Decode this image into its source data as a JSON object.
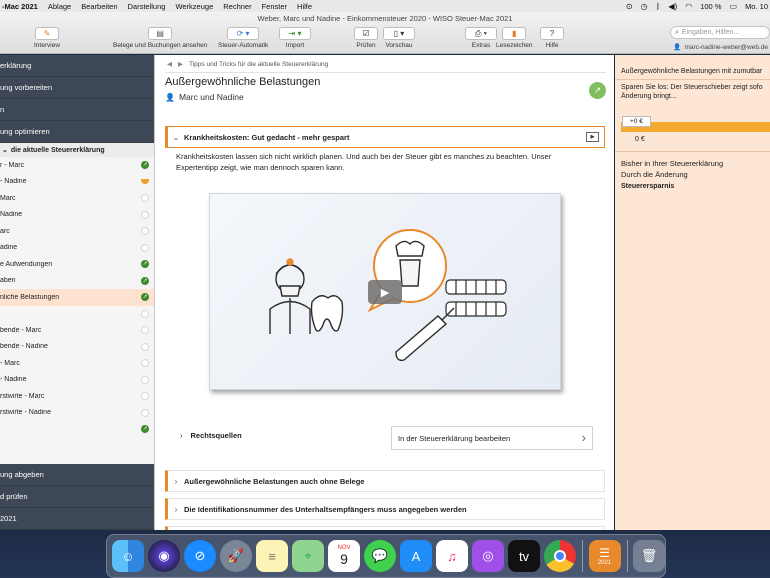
{
  "menubar": {
    "app": "-Mac 2021",
    "items": [
      "Ablage",
      "Bearbeiten",
      "Darstellung",
      "Werkzeuge",
      "Rechner",
      "Fenster",
      "Hilfe"
    ],
    "battery": "100 %",
    "day": "Mo. 10"
  },
  "window": {
    "title": "Weber, Marc und Nadine - Einkommensteuer 2020 - WISO Steuer-Mac 2021"
  },
  "toolbar": {
    "interview": "Interview",
    "belege": "Belege und Buchungen ansehen",
    "automatik": "Steuer-Automatik",
    "import": "Import",
    "pruefen": "Prüfen",
    "vorschau": "Vorschau",
    "extras": "Extras",
    "lesezeichen": "Lesezeichen",
    "hilfe": "Hilfe",
    "search_placeholder": "Eingaben, Hilfen...",
    "user": "marc-nadine-weber@web.de"
  },
  "sidebar": {
    "top": [
      "erklärung",
      "ung vorbereiten",
      "n",
      "ung optimieren"
    ],
    "section": "die aktuelle Steuererklärung",
    "items": [
      {
        "label": "r - Marc",
        "status": "done"
      },
      {
        "label": "- Nadine",
        "status": "partial"
      },
      {
        "label": "Marc",
        "status": "empty"
      },
      {
        "label": "Nadine",
        "status": "empty"
      },
      {
        "label": "arc",
        "status": "empty"
      },
      {
        "label": "adine",
        "status": "empty"
      },
      {
        "label": "e Aufwendungen",
        "status": "done"
      },
      {
        "label": "aben",
        "status": "done"
      },
      {
        "label": "nliche Belastungen",
        "status": "done",
        "active": true
      },
      {
        "label": "",
        "status": "empty"
      },
      {
        "label": "bende - Marc",
        "status": "empty"
      },
      {
        "label": "bende - Nadine",
        "status": "empty"
      },
      {
        "label": "- Marc",
        "status": "empty"
      },
      {
        "label": "- Nadine",
        "status": "empty"
      },
      {
        "label": "rstwirte - Marc",
        "status": "empty"
      },
      {
        "label": "rstwirte - Nadine",
        "status": "empty"
      },
      {
        "label": "",
        "status": "done"
      }
    ],
    "bottom": [
      "ung abgeben",
      "d prüfen",
      "2021"
    ]
  },
  "main": {
    "breadcrumb": "Tipps und Tricks für die aktuelle Steuererklärung",
    "title": "Außergewöhnliche Belastungen",
    "subtitle": "Marc und Nadine",
    "accordion_open": "Krankheitskosten: Gut gedacht - mehr gespart",
    "body_text": "Krankheitskosten lassen sich nicht wirklich planen. Und auch bei der Steuer gibt es manches zu beachten. Unser Expertentipp zeigt, wie man dennoch sparen kann.",
    "rechtsquellen": "Rechtsquellen",
    "edit_button": "In der Steuererklärung bearbeiten",
    "accordion2": "Außergewöhnliche Belastungen auch ohne Belege",
    "accordion3": "Die Identifikationsnummer des Unterhaltsempfängers muss angegeben werden"
  },
  "rpanel": {
    "title": "Außergewöhnliche Belastungen mit zumutbar",
    "desc1": "Sparen Sie los: Der Steuerschieber zeigt sofo",
    "desc2": "Änderung bringt...",
    "badge": "+0 €",
    "zero": "0 €",
    "t1a": "Bisher in Ihrer Steuererklärung",
    "t1b": "Durch die Änderung",
    "t2": "Steuerersparnis"
  },
  "dock": {
    "calendar_month": "NOV",
    "calendar_day": "9",
    "wiso_label": "2021",
    "icons": [
      "finder-icon",
      "siri-icon",
      "safari-icon",
      "launchpad-icon",
      "notes-icon",
      "maps-icon",
      "calendar-icon",
      "messages-icon",
      "app-store-icon",
      "music-icon",
      "podcasts-icon",
      "apple-tv-icon",
      "chrome-icon",
      "wiso-icon",
      "trash-icon"
    ]
  }
}
